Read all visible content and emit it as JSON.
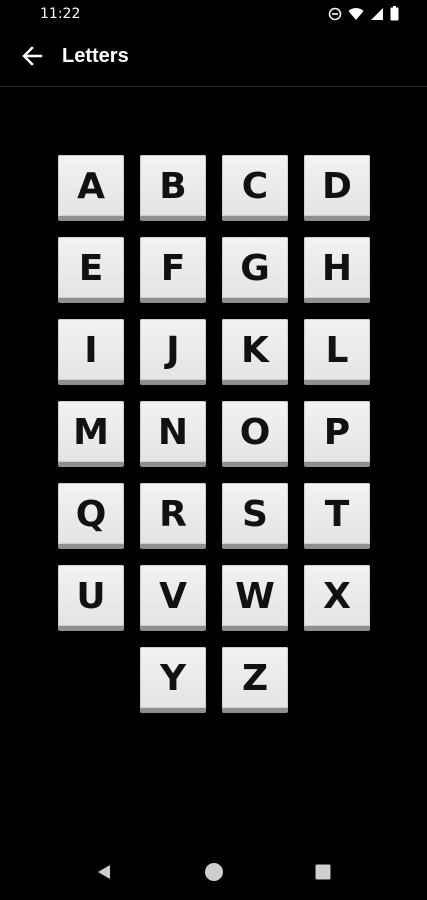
{
  "status_bar": {
    "time": "11:22",
    "icons": [
      "do-not-disturb-icon",
      "wifi-icon",
      "signal-icon",
      "battery-icon"
    ]
  },
  "app_bar": {
    "title": "Letters",
    "back_icon": "arrow-left-icon"
  },
  "letters": [
    "A",
    "B",
    "C",
    "D",
    "E",
    "F",
    "G",
    "H",
    "I",
    "J",
    "K",
    "L",
    "M",
    "N",
    "O",
    "P",
    "Q",
    "R",
    "S",
    "T",
    "U",
    "V",
    "W",
    "X",
    "Y",
    "Z"
  ],
  "nav_bar": {
    "buttons": [
      "back-triangle-icon",
      "home-circle-icon",
      "recents-square-icon"
    ]
  },
  "colors": {
    "background": "#000000",
    "tile_face": "#efefef",
    "tile_shadow": "#8f8f8f",
    "letter": "#111111",
    "nav_icon": "#cfcfcf"
  }
}
